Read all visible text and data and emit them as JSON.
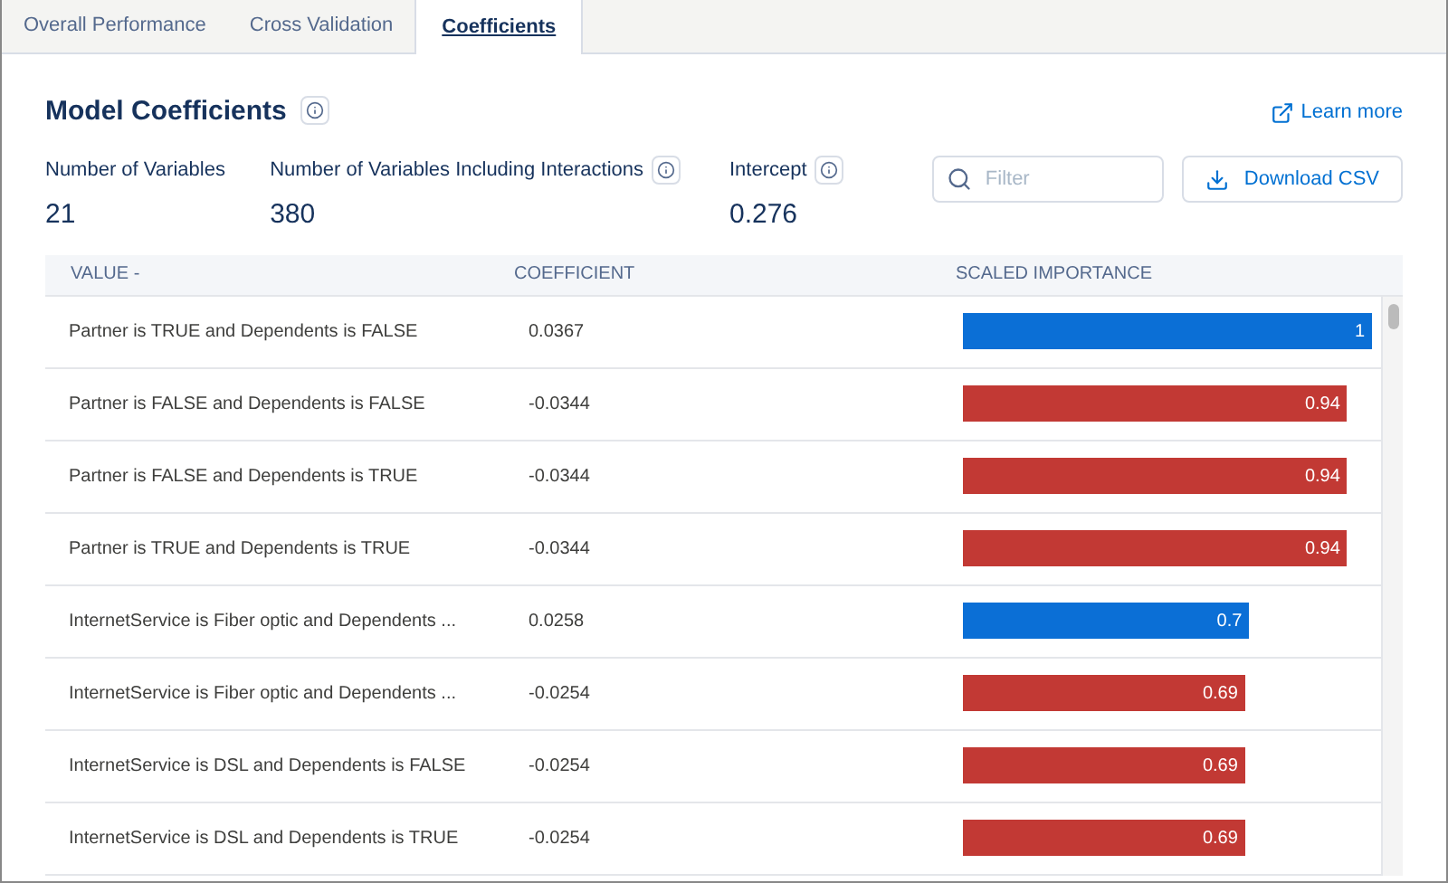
{
  "tabs": [
    {
      "label": "Overall Performance",
      "selected": false
    },
    {
      "label": "Cross Validation",
      "selected": false
    },
    {
      "label": "Coefficients",
      "selected": true
    }
  ],
  "title": "Model Coefficients",
  "learn_more": "Learn more",
  "stats": [
    {
      "label": "Number of Variables",
      "value": "21",
      "info": false
    },
    {
      "label": "Number of Variables Including Interactions",
      "value": "380",
      "info": true
    },
    {
      "label": "Intercept",
      "value": "0.276",
      "info": true
    }
  ],
  "filter": {
    "placeholder": "Filter"
  },
  "download_button": "Download CSV",
  "table": {
    "columns": [
      "VALUE",
      "COEFFICIENT",
      "SCALED IMPORTANCE"
    ],
    "sort_mark": "-",
    "rows": [
      {
        "value": "Partner is TRUE and Dependents is FALSE",
        "coefficient": "0.0367",
        "importance": "1",
        "color": "#0b6fd6"
      },
      {
        "value": "Partner is FALSE and Dependents is FALSE",
        "coefficient": "-0.0344",
        "importance": "0.94",
        "color": "#c23934"
      },
      {
        "value": "Partner is FALSE and Dependents is TRUE",
        "coefficient": "-0.0344",
        "importance": "0.94",
        "color": "#c23934"
      },
      {
        "value": "Partner is TRUE and Dependents is TRUE",
        "coefficient": "-0.0344",
        "importance": "0.94",
        "color": "#c23934"
      },
      {
        "value": "InternetService is Fiber optic and Dependents ...",
        "coefficient": "0.0258",
        "importance": "0.7",
        "color": "#0b6fd6"
      },
      {
        "value": "InternetService is Fiber optic and Dependents ...",
        "coefficient": "-0.0254",
        "importance": "0.69",
        "color": "#c23934"
      },
      {
        "value": "InternetService is DSL and Dependents is FALSE",
        "coefficient": "-0.0254",
        "importance": "0.69",
        "color": "#c23934"
      },
      {
        "value": "InternetService is DSL and Dependents is TRUE",
        "coefficient": "-0.0254",
        "importance": "0.69",
        "color": "#c23934"
      }
    ]
  }
}
